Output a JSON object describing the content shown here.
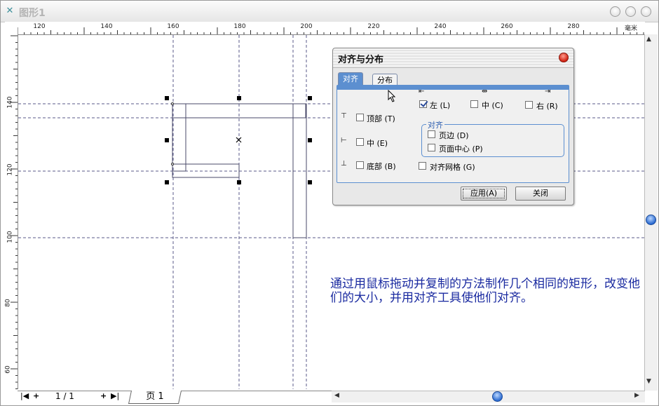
{
  "window": {
    "title": "图形1",
    "app_icon": "x-icon"
  },
  "ruler": {
    "unit": "毫米",
    "top_labels": [
      "120",
      "140",
      "160",
      "180",
      "200",
      "220",
      "240",
      "260",
      "280"
    ],
    "left_labels": [
      "140",
      "120",
      "100",
      "80",
      "60"
    ],
    "left_unit": "毫米"
  },
  "pagebar": {
    "first": "|◀",
    "add_before": "+",
    "page_counter": "1  /  1",
    "add_after": "+",
    "last": "▶|",
    "page_tab": "页  1"
  },
  "dialog": {
    "title": "对齐与分布",
    "tabs": [
      "对齐",
      "分布"
    ],
    "horizontal": {
      "left": {
        "label": "左",
        "shortcut": "(L)",
        "checked": true
      },
      "center": {
        "label": "中",
        "shortcut": "(C)",
        "checked": false
      },
      "right": {
        "label": "右",
        "shortcut": "(R)",
        "checked": false
      }
    },
    "vertical": {
      "top": {
        "label": "顶部",
        "shortcut": "(T)",
        "checked": false
      },
      "middle": {
        "label": "中",
        "shortcut": "(E)",
        "checked": false
      },
      "bottom": {
        "label": "底部",
        "shortcut": "(B)",
        "checked": false
      }
    },
    "align_to": {
      "title": "对齐",
      "page_edge": {
        "label": "页边",
        "shortcut": "(D)",
        "checked": false
      },
      "page_center": {
        "label": "页面中心",
        "shortcut": "(P)",
        "checked": false
      }
    },
    "snap_grid": {
      "label": "对齐网格",
      "shortcut": "(G)",
      "checked": false
    },
    "apply_button": "应用",
    "apply_shortcut": "(A)",
    "close_button": "关闭"
  },
  "annotation": {
    "text": "通过用鼠标拖动并复制的方法制作几个相同的矩形，改变他们的大小，并用对齐工具使他们对齐。"
  },
  "colors": {
    "accent": "#5c8fd0",
    "annotation": "#1a2aa0",
    "guide": "#5a5a8a"
  }
}
